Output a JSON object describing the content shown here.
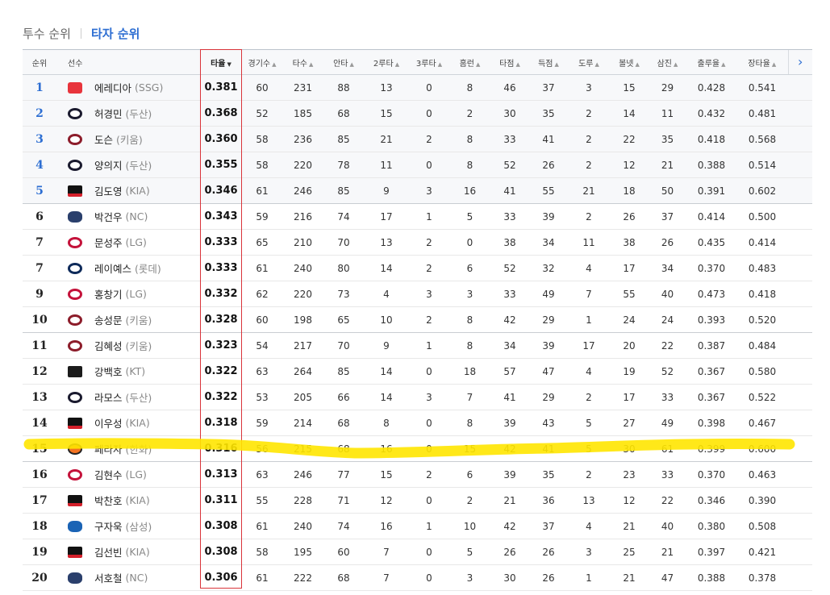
{
  "tabs": {
    "pitcher": "투수 순위",
    "batter": "타자 순위"
  },
  "colors": {
    "accent": "#2d6ed2",
    "sortBox": "#d9343a",
    "highlighter": "#ffe600"
  },
  "table": {
    "headers": {
      "rank": "순위",
      "player": "선수",
      "avg": "타율",
      "games": "경기수",
      "ab": "타수",
      "hits": "안타",
      "doubles": "2루타",
      "triples": "3루타",
      "hr": "홈런",
      "rbi": "타점",
      "runs": "득점",
      "sb": "도루",
      "bb": "볼넷",
      "so": "삼진",
      "obp": "출루율",
      "slg": "장타율"
    },
    "sort_arrow_down": "▼",
    "sort_arrow_up": "▲",
    "next_icon": "›",
    "rows": [
      {
        "rank": "1",
        "name": "에레디아",
        "team": "(SSG)",
        "logo": "ssg-logo-icon",
        "avg": "0.381",
        "games": "60",
        "ab": "231",
        "hits": "88",
        "doubles": "13",
        "triples": "0",
        "hr": "8",
        "rbi": "46",
        "runs": "37",
        "sb": "3",
        "bb": "15",
        "so": "29",
        "obp": "0.428",
        "slg": "0.541"
      },
      {
        "rank": "2",
        "name": "허경민",
        "team": "(두산)",
        "logo": "doosan-logo-icon",
        "avg": "0.368",
        "games": "52",
        "ab": "185",
        "hits": "68",
        "doubles": "15",
        "triples": "0",
        "hr": "2",
        "rbi": "30",
        "runs": "35",
        "sb": "2",
        "bb": "14",
        "so": "11",
        "obp": "0.432",
        "slg": "0.481"
      },
      {
        "rank": "3",
        "name": "도슨",
        "team": "(키움)",
        "logo": "kiwoom-logo-icon",
        "avg": "0.360",
        "games": "58",
        "ab": "236",
        "hits": "85",
        "doubles": "21",
        "triples": "2",
        "hr": "8",
        "rbi": "33",
        "runs": "41",
        "sb": "2",
        "bb": "22",
        "so": "35",
        "obp": "0.418",
        "slg": "0.568"
      },
      {
        "rank": "4",
        "name": "양의지",
        "team": "(두산)",
        "logo": "doosan-logo-icon",
        "avg": "0.355",
        "games": "58",
        "ab": "220",
        "hits": "78",
        "doubles": "11",
        "triples": "0",
        "hr": "8",
        "rbi": "52",
        "runs": "26",
        "sb": "2",
        "bb": "12",
        "so": "21",
        "obp": "0.388",
        "slg": "0.514"
      },
      {
        "rank": "5",
        "name": "김도영",
        "team": "(KIA)",
        "logo": "kia-logo-icon",
        "avg": "0.346",
        "games": "61",
        "ab": "246",
        "hits": "85",
        "doubles": "9",
        "triples": "3",
        "hr": "16",
        "rbi": "41",
        "runs": "55",
        "sb": "21",
        "bb": "18",
        "so": "50",
        "obp": "0.391",
        "slg": "0.602"
      },
      {
        "rank": "6",
        "name": "박건우",
        "team": "(NC)",
        "logo": "nc-logo-icon",
        "avg": "0.343",
        "games": "59",
        "ab": "216",
        "hits": "74",
        "doubles": "17",
        "triples": "1",
        "hr": "5",
        "rbi": "33",
        "runs": "39",
        "sb": "2",
        "bb": "26",
        "so": "37",
        "obp": "0.414",
        "slg": "0.500"
      },
      {
        "rank": "7",
        "name": "문성주",
        "team": "(LG)",
        "logo": "lg-logo-icon",
        "avg": "0.333",
        "games": "65",
        "ab": "210",
        "hits": "70",
        "doubles": "13",
        "triples": "2",
        "hr": "0",
        "rbi": "38",
        "runs": "34",
        "sb": "11",
        "bb": "38",
        "so": "26",
        "obp": "0.435",
        "slg": "0.414"
      },
      {
        "rank": "7",
        "name": "레이예스",
        "team": "(롯데)",
        "logo": "lotte-logo-icon",
        "avg": "0.333",
        "games": "61",
        "ab": "240",
        "hits": "80",
        "doubles": "14",
        "triples": "2",
        "hr": "6",
        "rbi": "52",
        "runs": "32",
        "sb": "4",
        "bb": "17",
        "so": "34",
        "obp": "0.370",
        "slg": "0.483"
      },
      {
        "rank": "9",
        "name": "홍창기",
        "team": "(LG)",
        "logo": "lg-logo-icon",
        "avg": "0.332",
        "games": "62",
        "ab": "220",
        "hits": "73",
        "doubles": "4",
        "triples": "3",
        "hr": "3",
        "rbi": "33",
        "runs": "49",
        "sb": "7",
        "bb": "55",
        "so": "40",
        "obp": "0.473",
        "slg": "0.418"
      },
      {
        "rank": "10",
        "name": "송성문",
        "team": "(키움)",
        "logo": "kiwoom-logo-icon",
        "avg": "0.328",
        "games": "60",
        "ab": "198",
        "hits": "65",
        "doubles": "10",
        "triples": "2",
        "hr": "8",
        "rbi": "42",
        "runs": "29",
        "sb": "1",
        "bb": "24",
        "so": "24",
        "obp": "0.393",
        "slg": "0.520"
      },
      {
        "rank": "11",
        "name": "김혜성",
        "team": "(키움)",
        "logo": "kiwoom-logo-icon",
        "avg": "0.323",
        "games": "54",
        "ab": "217",
        "hits": "70",
        "doubles": "9",
        "triples": "1",
        "hr": "8",
        "rbi": "34",
        "runs": "39",
        "sb": "17",
        "bb": "20",
        "so": "22",
        "obp": "0.387",
        "slg": "0.484"
      },
      {
        "rank": "12",
        "name": "강백호",
        "team": "(KT)",
        "logo": "kt-logo-icon",
        "avg": "0.322",
        "games": "63",
        "ab": "264",
        "hits": "85",
        "doubles": "14",
        "triples": "0",
        "hr": "18",
        "rbi": "57",
        "runs": "47",
        "sb": "4",
        "bb": "19",
        "so": "52",
        "obp": "0.367",
        "slg": "0.580"
      },
      {
        "rank": "13",
        "name": "라모스",
        "team": "(두산)",
        "logo": "doosan-logo-icon",
        "avg": "0.322",
        "games": "53",
        "ab": "205",
        "hits": "66",
        "doubles": "14",
        "triples": "3",
        "hr": "7",
        "rbi": "41",
        "runs": "29",
        "sb": "2",
        "bb": "17",
        "so": "33",
        "obp": "0.367",
        "slg": "0.522"
      },
      {
        "rank": "14",
        "name": "이우성",
        "team": "(KIA)",
        "logo": "kia-logo-icon",
        "avg": "0.318",
        "games": "59",
        "ab": "214",
        "hits": "68",
        "doubles": "8",
        "triples": "0",
        "hr": "8",
        "rbi": "39",
        "runs": "43",
        "sb": "5",
        "bb": "27",
        "so": "49",
        "obp": "0.398",
        "slg": "0.467"
      },
      {
        "rank": "15",
        "name": "페라자",
        "team": "(한화)",
        "logo": "hanwha-logo-icon",
        "avg": "0.316",
        "games": "56",
        "ab": "215",
        "hits": "68",
        "doubles": "16",
        "triples": "0",
        "hr": "15",
        "rbi": "42",
        "runs": "41",
        "sb": "5",
        "bb": "30",
        "so": "61",
        "obp": "0.399",
        "slg": "0.600"
      },
      {
        "rank": "16",
        "name": "김현수",
        "team": "(LG)",
        "logo": "lg-logo-icon",
        "avg": "0.313",
        "games": "63",
        "ab": "246",
        "hits": "77",
        "doubles": "15",
        "triples": "2",
        "hr": "6",
        "rbi": "39",
        "runs": "35",
        "sb": "2",
        "bb": "23",
        "so": "33",
        "obp": "0.370",
        "slg": "0.463"
      },
      {
        "rank": "17",
        "name": "박찬호",
        "team": "(KIA)",
        "logo": "kia-logo-icon",
        "avg": "0.311",
        "games": "55",
        "ab": "228",
        "hits": "71",
        "doubles": "12",
        "triples": "0",
        "hr": "2",
        "rbi": "21",
        "runs": "36",
        "sb": "13",
        "bb": "12",
        "so": "22",
        "obp": "0.346",
        "slg": "0.390"
      },
      {
        "rank": "18",
        "name": "구자욱",
        "team": "(삼성)",
        "logo": "samsung-logo-icon",
        "avg": "0.308",
        "games": "61",
        "ab": "240",
        "hits": "74",
        "doubles": "16",
        "triples": "1",
        "hr": "10",
        "rbi": "42",
        "runs": "37",
        "sb": "4",
        "bb": "21",
        "so": "40",
        "obp": "0.380",
        "slg": "0.508"
      },
      {
        "rank": "19",
        "name": "김선빈",
        "team": "(KIA)",
        "logo": "kia-logo-icon",
        "avg": "0.308",
        "games": "58",
        "ab": "195",
        "hits": "60",
        "doubles": "7",
        "triples": "0",
        "hr": "5",
        "rbi": "26",
        "runs": "26",
        "sb": "3",
        "bb": "25",
        "so": "21",
        "obp": "0.397",
        "slg": "0.421"
      },
      {
        "rank": "20",
        "name": "서호철",
        "team": "(NC)",
        "logo": "nc-logo-icon",
        "avg": "0.306",
        "games": "61",
        "ab": "222",
        "hits": "68",
        "doubles": "7",
        "triples": "0",
        "hr": "3",
        "rbi": "30",
        "runs": "26",
        "sb": "1",
        "bb": "21",
        "so": "47",
        "obp": "0.388",
        "slg": "0.378"
      }
    ]
  }
}
